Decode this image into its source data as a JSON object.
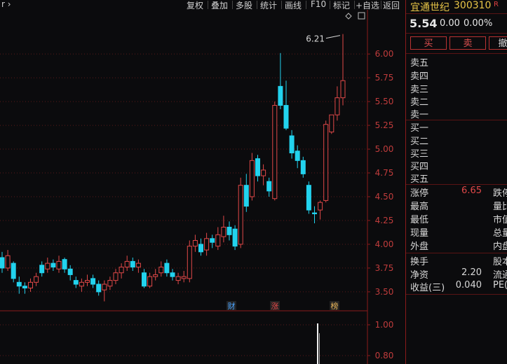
{
  "toolbar": {
    "left_glyph": "r ›",
    "items": [
      "复权",
      "叠加",
      "多股",
      "统计",
      "画线",
      "F10",
      "标记",
      "+自选",
      "返回"
    ]
  },
  "stock": {
    "name": "宜通世纪",
    "code": "300310",
    "badge": "R",
    "price": "5.54",
    "change": "0.00",
    "change_pct": "0.00%"
  },
  "trade_buttons": {
    "buy": "买",
    "sell": "卖",
    "more": "撤"
  },
  "order_book": {
    "asks": [
      "卖五",
      "卖四",
      "卖三",
      "卖二",
      "卖一"
    ],
    "bids": [
      "买一",
      "买二",
      "买三",
      "买四",
      "买五"
    ]
  },
  "stats": [
    {
      "label": "涨停",
      "value": "6.65",
      "right_label": "跌停"
    },
    {
      "label": "最高",
      "value": "",
      "right_label": "量比"
    },
    {
      "label": "最低",
      "value": "",
      "right_label": "市值"
    },
    {
      "label": "现量",
      "value": "",
      "right_label": "总量"
    },
    {
      "label": "外盘",
      "value": "",
      "right_label": "内盘"
    }
  ],
  "stats2": [
    {
      "label": "换手",
      "value": "",
      "right_label": "股本"
    },
    {
      "label": "净资",
      "value": "2.20",
      "right_label": "流通"
    },
    {
      "label": "收益(三)",
      "value": "0.040",
      "right_label": "PE("
    }
  ],
  "chart_data": {
    "type": "candlestick",
    "y_axis_ticks": [
      3.5,
      3.75,
      4.0,
      4.25,
      4.5,
      4.75,
      5.0,
      5.25,
      5.5,
      5.75,
      6.0
    ],
    "ylim": [
      3.33,
      6.45
    ],
    "high_marker": "6.21",
    "event_tags": [
      "财",
      "涨",
      "榜"
    ],
    "volume_axis_ticks": [
      "1.00",
      "0.80"
    ],
    "up_color": "#e04848",
    "down_color": "#22d3ee",
    "candles": [
      [
        3.86,
        3.75,
        3.92,
        3.7
      ],
      [
        3.75,
        3.88,
        3.94,
        3.72
      ],
      [
        3.8,
        3.64,
        3.82,
        3.6
      ],
      [
        3.6,
        3.56,
        3.66,
        3.48
      ],
      [
        3.56,
        3.54,
        3.6,
        3.48
      ],
      [
        3.54,
        3.6,
        3.64,
        3.5
      ],
      [
        3.6,
        3.66,
        3.7,
        3.56
      ],
      [
        3.78,
        3.7,
        3.82,
        3.66
      ],
      [
        3.74,
        3.8,
        3.86,
        3.7
      ],
      [
        3.8,
        3.76,
        3.84,
        3.72
      ],
      [
        3.74,
        3.82,
        3.88,
        3.7
      ],
      [
        3.84,
        3.74,
        3.86,
        3.7
      ],
      [
        3.74,
        3.68,
        3.78,
        3.62
      ],
      [
        3.62,
        3.58,
        3.66,
        3.54
      ],
      [
        3.56,
        3.6,
        3.64,
        3.5
      ],
      [
        3.6,
        3.62,
        3.68,
        3.56
      ],
      [
        3.64,
        3.58,
        3.68,
        3.54
      ],
      [
        3.58,
        3.5,
        3.62,
        3.46
      ],
      [
        3.52,
        3.58,
        3.62,
        3.4
      ],
      [
        3.56,
        3.62,
        3.66,
        3.52
      ],
      [
        3.62,
        3.7,
        3.74,
        3.58
      ],
      [
        3.7,
        3.76,
        3.8,
        3.64
      ],
      [
        3.76,
        3.82,
        3.88,
        3.72
      ],
      [
        3.82,
        3.76,
        3.86,
        3.72
      ],
      [
        3.76,
        3.8,
        3.84,
        3.7
      ],
      [
        3.7,
        3.56,
        3.74,
        3.54
      ],
      [
        3.56,
        3.66,
        3.7,
        3.54
      ],
      [
        3.66,
        3.68,
        3.74,
        3.62
      ],
      [
        3.7,
        3.76,
        3.82,
        3.66
      ],
      [
        3.8,
        3.7,
        3.84,
        3.66
      ],
      [
        3.7,
        3.66,
        3.74,
        3.62
      ],
      [
        3.62,
        3.66,
        3.7,
        3.58
      ],
      [
        3.64,
        3.66,
        3.72,
        3.6
      ],
      [
        3.64,
        3.98,
        4.04,
        3.6
      ],
      [
        3.98,
        4.04,
        4.1,
        3.92
      ],
      [
        4.0,
        3.92,
        4.06,
        3.88
      ],
      [
        3.94,
        4.06,
        4.12,
        3.88
      ],
      [
        4.06,
        4.02,
        4.1,
        3.96
      ],
      [
        3.98,
        4.1,
        4.18,
        3.94
      ],
      [
        4.08,
        4.18,
        4.3,
        4.02
      ],
      [
        4.18,
        4.1,
        4.24,
        4.04
      ],
      [
        4.16,
        3.98,
        4.2,
        3.94
      ],
      [
        4.0,
        4.62,
        4.7,
        3.96
      ],
      [
        4.62,
        4.4,
        4.74,
        4.34
      ],
      [
        4.5,
        4.88,
        4.96,
        4.46
      ],
      [
        4.9,
        4.72,
        4.94,
        4.66
      ],
      [
        4.72,
        4.78,
        4.84,
        4.62
      ],
      [
        4.66,
        4.56,
        4.7,
        4.5
      ],
      [
        4.48,
        5.46,
        5.5,
        4.46
      ],
      [
        5.66,
        5.46,
        6.01,
        5.42
      ],
      [
        5.46,
        5.22,
        5.72,
        5.2
      ],
      [
        5.14,
        4.96,
        5.2,
        4.9
      ],
      [
        4.98,
        4.88,
        5.04,
        4.8
      ],
      [
        4.88,
        4.74,
        4.92,
        4.7
      ],
      [
        4.62,
        4.36,
        4.66,
        4.32
      ],
      [
        4.33,
        4.32,
        4.4,
        4.22
      ],
      [
        4.36,
        4.44,
        4.46,
        4.26
      ],
      [
        4.46,
        5.26,
        5.3,
        4.44
      ],
      [
        5.18,
        5.36,
        5.36,
        5.16
      ],
      [
        5.36,
        5.54,
        5.66,
        5.3
      ],
      [
        5.54,
        5.72,
        6.21,
        5.46
      ]
    ]
  }
}
